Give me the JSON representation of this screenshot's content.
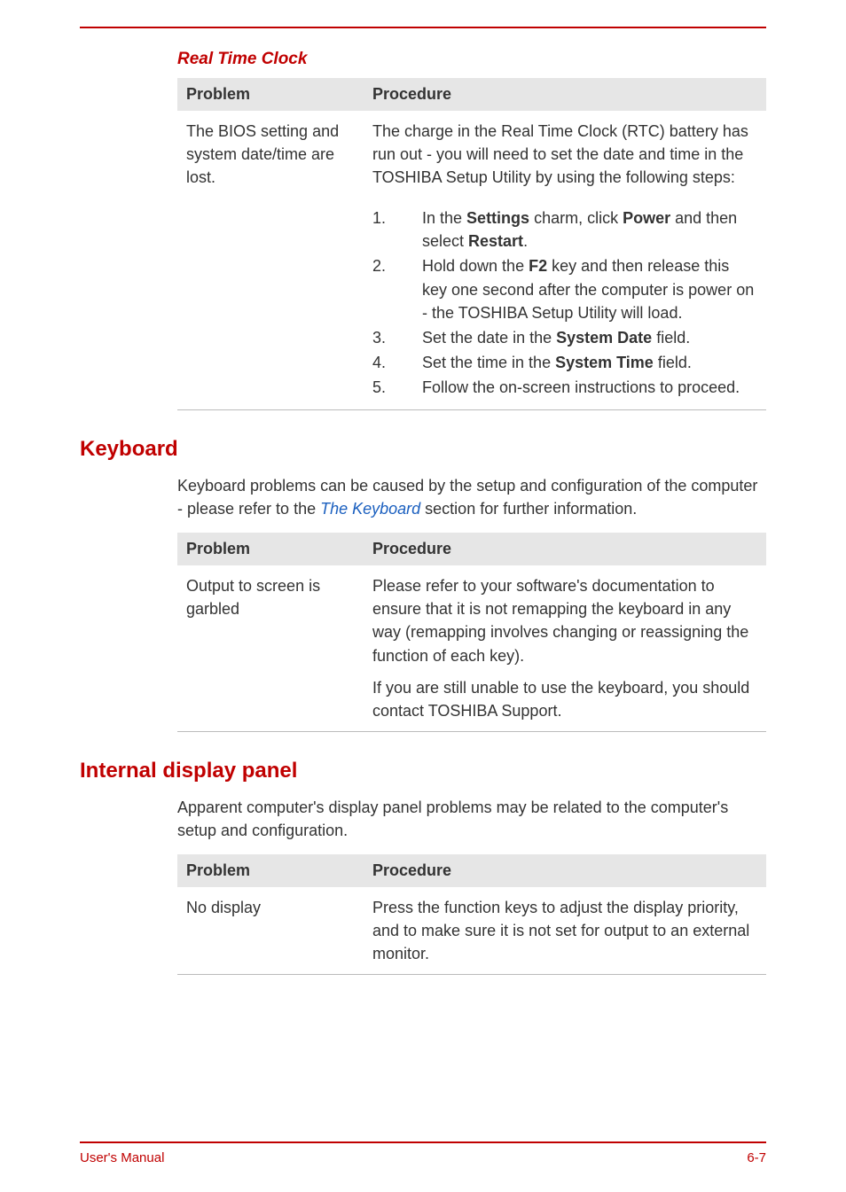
{
  "sections": {
    "rtc": {
      "title": "Real Time Clock",
      "table": {
        "head": {
          "problem": "Problem",
          "procedure": "Procedure"
        },
        "row": {
          "problem": "The BIOS setting and system date/time are lost.",
          "intro": "The charge in the Real Time Clock (RTC) battery has run out - you will need to set the date and time in the TOSHIBA Setup Utility by using the following steps:",
          "steps": {
            "s1_a": "In the ",
            "s1_b": "Settings",
            "s1_c": " charm, click ",
            "s1_d": "Power",
            "s1_e": " and then select ",
            "s1_f": "Restart",
            "s1_g": ".",
            "s2_a": "Hold down the ",
            "s2_b": "F2",
            "s2_c": " key and then release this key one second after the computer is power on - the TOSHIBA Setup Utility will load.",
            "s3_a": "Set the date in the ",
            "s3_b": "System Date",
            "s3_c": " field.",
            "s4_a": "Set the time in the ",
            "s4_b": "System Time",
            "s4_c": " field.",
            "s5": "Follow the on-screen instructions to proceed."
          },
          "nums": {
            "n1": "1.",
            "n2": "2.",
            "n3": "3.",
            "n4": "4.",
            "n5": "5."
          }
        }
      }
    },
    "keyboard": {
      "title": "Keyboard",
      "intro_a": "Keyboard problems can be caused by the setup and configuration of the computer - please refer to the ",
      "intro_link": "The Keyboard",
      "intro_b": " section for further information.",
      "table": {
        "head": {
          "problem": "Problem",
          "procedure": "Procedure"
        },
        "row": {
          "problem": "Output to screen is garbled",
          "p1": "Please refer to your software's documentation to ensure that it is not remapping the keyboard in any way (remapping involves changing or reassigning the function of each key).",
          "p2": "If you are still unable to use the keyboard, you should contact TOSHIBA Support."
        }
      }
    },
    "display": {
      "title": "Internal display panel",
      "intro": "Apparent computer's display panel problems may be related to the computer's setup and configuration.",
      "table": {
        "head": {
          "problem": "Problem",
          "procedure": "Procedure"
        },
        "row": {
          "problem": "No display",
          "p1": "Press the function keys to adjust the display priority, and to make sure it is not set for output to an external monitor."
        }
      }
    }
  },
  "footer": {
    "left": "User's Manual",
    "right": "6-7"
  }
}
